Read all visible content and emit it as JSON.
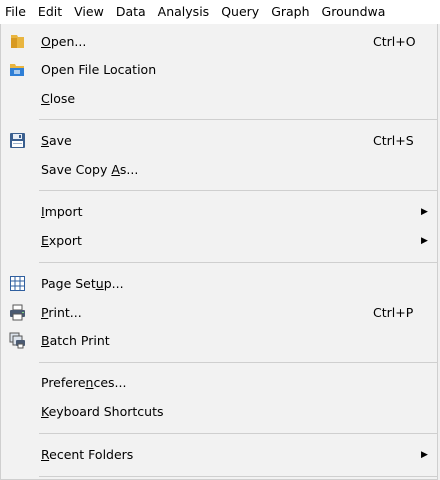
{
  "menubar": {
    "items": [
      "File",
      "Edit",
      "View",
      "Data",
      "Analysis",
      "Query",
      "Graph",
      "Groundwa"
    ]
  },
  "file_menu": {
    "open": {
      "pre": "",
      "key": "O",
      "post": "pen...",
      "shortcut": "Ctrl+O"
    },
    "open_file_location": {
      "label": "Open File Location"
    },
    "close": {
      "pre": "",
      "key": "C",
      "post": "lose"
    },
    "save": {
      "pre": "",
      "key": "S",
      "post": "ave",
      "shortcut": "Ctrl+S"
    },
    "save_copy_as": {
      "pre": "Save Copy ",
      "key": "A",
      "post": "s..."
    },
    "import": {
      "pre": "",
      "key": "I",
      "post": "mport"
    },
    "export": {
      "pre": "",
      "key": "E",
      "post": "xport"
    },
    "page_setup": {
      "pre": "Page Set",
      "key": "u",
      "post": "p..."
    },
    "print": {
      "pre": "",
      "key": "P",
      "post": "rint...",
      "shortcut": "Ctrl+P"
    },
    "batch_print": {
      "pre": "",
      "key": "B",
      "post": "atch Print"
    },
    "preferences": {
      "pre": "Prefere",
      "key": "n",
      "post": "ces..."
    },
    "keyboard_shortcuts": {
      "pre": "",
      "key": "K",
      "post": "eyboard Shortcuts"
    },
    "recent_folders": {
      "pre": "",
      "key": "R",
      "post": "ecent Folders"
    },
    "submenu_arrow": "▶"
  },
  "icons": {
    "open": "folder-icon",
    "open_file_location": "folder-location-icon",
    "save": "floppy-disk-icon",
    "page_setup": "page-setup-icon",
    "print": "printer-icon",
    "batch_print": "batch-print-icon"
  },
  "colors": {
    "menu_background": "#f2f2f2",
    "menubar_background": "#ffffff",
    "separator": "#cfcfcf"
  }
}
